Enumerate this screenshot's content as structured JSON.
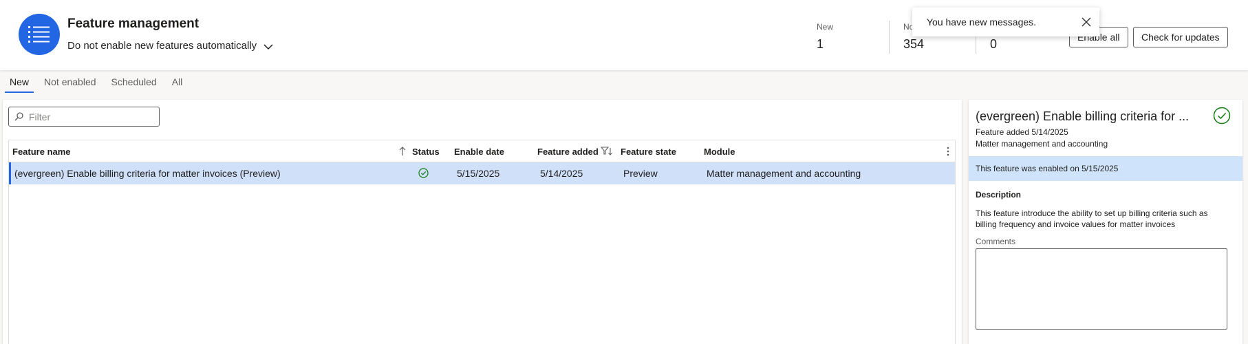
{
  "header": {
    "title": "Feature management",
    "auto_enable_selection": "Do not enable new features automatically",
    "icons": {
      "logo": "checklist-icon",
      "dropdown": "chevron-down-icon"
    }
  },
  "stats": [
    {
      "label": "New",
      "value": "1"
    },
    {
      "label": "No",
      "value": "354"
    },
    {
      "label": "",
      "value": "0"
    }
  ],
  "buttons": {
    "enable_all": "Enable all",
    "check_updates": "Check for updates"
  },
  "toast": {
    "message": "You have new messages.",
    "close_icon": "close-icon"
  },
  "tabs": [
    {
      "label": "New",
      "active": true
    },
    {
      "label": "Not enabled",
      "active": false
    },
    {
      "label": "Scheduled",
      "active": false
    },
    {
      "label": "All",
      "active": false
    }
  ],
  "filter": {
    "placeholder": "Filter",
    "icon": "search-icon"
  },
  "grid": {
    "columns": {
      "feature_name": "Feature name",
      "status": "Status",
      "enable_date": "Enable date",
      "feature_added": "Feature added",
      "feature_state": "Feature state",
      "module": "Module"
    },
    "rows": [
      {
        "feature_name": "(evergreen) Enable billing criteria for matter invoices (Preview)",
        "status": "enabled",
        "enable_date": "5/15/2025",
        "feature_added": "5/14/2025",
        "feature_state": "Preview",
        "module": "Matter management and accounting"
      }
    ]
  },
  "detail": {
    "title": "(evergreen) Enable billing criteria for ...",
    "feature_added": "Feature added 5/14/2025",
    "module": "Matter management and accounting",
    "banner": "This feature was enabled on 5/15/2025",
    "description_label": "Description",
    "description": "This feature introduce the ability to set up billing criteria such as billing frequency and invoice values for matter invoices",
    "comments_label": "Comments",
    "comments_value": ""
  },
  "colors": {
    "accent": "#2266e3",
    "success": "#107c10",
    "selected_row": "#cfe0f8"
  }
}
